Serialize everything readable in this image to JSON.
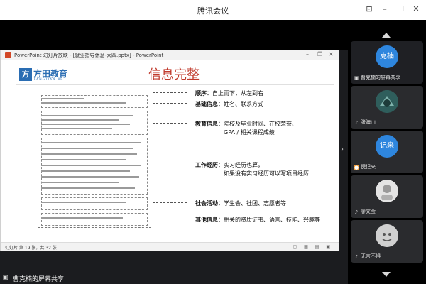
{
  "window": {
    "title": "腾讯会议",
    "controls": [
      "⊡",
      "–",
      "☐",
      "✕"
    ]
  },
  "powerpoint": {
    "window_title": "PowerPoint 幻灯片放映 - [就业指导休息-大四.pptx] - PowerPoint",
    "status_text": "幻灯片 第 19 张，共 32 张",
    "status_icons": "▢ ▦ ▤ ▣",
    "slide": {
      "logo_cn": "方田教育",
      "logo_en": "FANGTIAN.NE",
      "title": "信息完整",
      "labels": [
        {
          "key": "顺序",
          "text": "：自上而下，从左到右"
        },
        {
          "key": "基础信息",
          "text": "：姓名、联系方式"
        },
        {
          "key": "教育信息",
          "text": "：院校及毕业时间、在校荣誉、"
        },
        {
          "key": "",
          "text": "GPA / 相关课程成绩"
        },
        {
          "key": "工作经历",
          "text": "：实习经历也算，"
        },
        {
          "key": "",
          "text": "如果没有实习经历可以写项目经历"
        },
        {
          "key": "社会活动",
          "text": "：学生会、社团、志愿者等"
        },
        {
          "key": "其他信息",
          "text": "：相关的资质证书、语言、技能、兴趣等"
        }
      ]
    }
  },
  "participants": [
    {
      "avatar_text": "克楠",
      "name": "曹克楠的屏幕共享",
      "avatar_color": "#2e86de",
      "icon": "share"
    },
    {
      "avatar_text": "",
      "name": "张海山",
      "avatar_color": "#3a6b6a",
      "icon": "mic"
    },
    {
      "avatar_text": "记来",
      "name": "倪记来",
      "avatar_color": "#2e86de",
      "icon": "user"
    },
    {
      "avatar_text": "",
      "name": "廖文莹",
      "avatar_color": "#d9d9d9",
      "icon": "mic"
    },
    {
      "avatar_text": "",
      "name": "无言不惧",
      "avatar_color": "#c8c8c8",
      "icon": "mic"
    }
  ],
  "bottom_bar": {
    "share_text": "曹克楠的屏幕共享"
  }
}
